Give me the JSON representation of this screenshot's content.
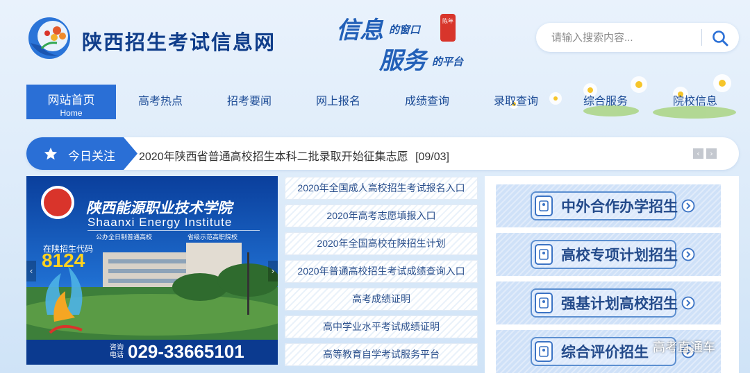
{
  "site": {
    "title": "陕西招生考试信息网",
    "slogan": {
      "line1_big": "信息",
      "line1_small": "的窗口",
      "line2_big": "服务",
      "line2_small": "的平台",
      "seal": "陈年"
    }
  },
  "search": {
    "placeholder": "请输入搜索内容..."
  },
  "nav": {
    "items": [
      {
        "label": "网站首页",
        "sub": "Home"
      },
      {
        "label": "高考热点"
      },
      {
        "label": "招考要闻"
      },
      {
        "label": "网上报名"
      },
      {
        "label": "成绩查询"
      },
      {
        "label": "录取查询"
      },
      {
        "label": "综合服务"
      },
      {
        "label": "院校信息"
      }
    ]
  },
  "today": {
    "label": "今日关注",
    "headline": "2020年陕西省普通高校招生本科二批录取开始征集志愿",
    "date": "[09/03]"
  },
  "banner": {
    "school_cn": "陕西能源职业技术学院",
    "school_en": "Shaanxi Energy Institute",
    "sub_left": "公办全日制普通高校",
    "sub_right": "省级示范高职院校",
    "code_label": "在陕招生代码",
    "code": "8124",
    "consult_label_1": "咨询",
    "consult_label_2": "电话",
    "phone": "029-33665101"
  },
  "links": [
    "2020年全国成人高校招生考试报名入口",
    "2020年高考志愿填报入口",
    "2020年全国高校在陕招生计划",
    "2020年普通高校招生考试成绩查询入口",
    "高考成绩证明",
    "高中学业水平考试成绩证明",
    "高等教育自学考试服务平台"
  ],
  "right_buttons": [
    "中外合作办学招生",
    "高校专项计划招生",
    "强基计划高校招生",
    "综合评价招生"
  ],
  "watermark": "高考直通车",
  "colors": {
    "primary": "#2a6fd6",
    "nav_text": "#1d4c96",
    "dark_blue": "#0f3d8a"
  }
}
